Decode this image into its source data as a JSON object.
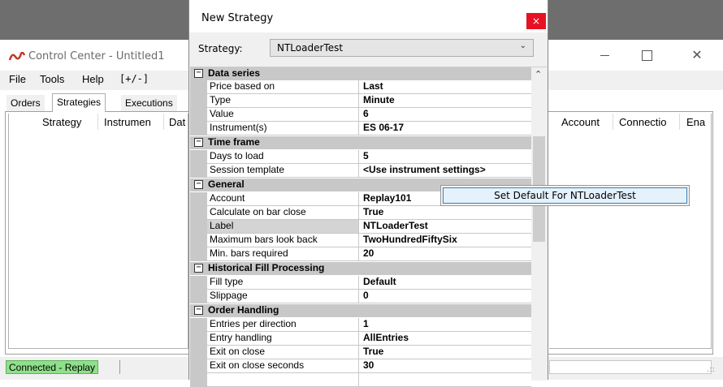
{
  "control_center": {
    "title": "Control Center - Untitled1",
    "menu": [
      "File",
      "Tools",
      "Help",
      "[+/-]"
    ],
    "tabs": [
      "Orders",
      "Strategies",
      "Executions"
    ],
    "columns_left": [
      "Strategy",
      "Instrumen",
      "Dat"
    ],
    "columns_right": [
      "Account",
      "Connectio",
      "Ena"
    ],
    "status": "Connected - Replay",
    "close_glyph": "✕",
    "logo_color": "#c0392b"
  },
  "dialog": {
    "title": "New Strategy",
    "close_glyph": "×",
    "strategy_label": "Strategy:",
    "strategy_value": "NTLoaderTest",
    "sections": [
      {
        "name": "Data series",
        "rows": [
          {
            "name": "Price based on",
            "value": "Last"
          },
          {
            "name": "Type",
            "value": "Minute"
          },
          {
            "name": "Value",
            "value": "6"
          },
          {
            "name": "Instrument(s)",
            "value": "ES 06-17"
          }
        ]
      },
      {
        "name": "Time frame",
        "rows": [
          {
            "name": "Days to load",
            "value": "5"
          },
          {
            "name": "Session template",
            "value": "<Use instrument settings>"
          }
        ]
      },
      {
        "name": "General",
        "rows": [
          {
            "name": "Account",
            "value": "Replay101"
          },
          {
            "name": "Calculate on bar close",
            "value": "True"
          },
          {
            "name": "Label",
            "value": "NTLoaderTest"
          },
          {
            "name": "Maximum bars look back",
            "value": "TwoHundredFiftySix"
          },
          {
            "name": "Min. bars required",
            "value": "20"
          }
        ]
      },
      {
        "name": "Historical Fill Processing",
        "rows": [
          {
            "name": "Fill type",
            "value": "Default"
          },
          {
            "name": "Slippage",
            "value": "0"
          }
        ]
      },
      {
        "name": "Order Handling",
        "rows": [
          {
            "name": "Entries per direction",
            "value": "1"
          },
          {
            "name": "Entry handling",
            "value": "AllEntries"
          },
          {
            "name": "Exit on close",
            "value": "True"
          },
          {
            "name": "Exit on close seconds",
            "value": "30"
          }
        ]
      }
    ]
  },
  "context_menu": {
    "item": "Set Default For NTLoaderTest"
  },
  "colors": {
    "status_green": "#8fe08b",
    "close_red": "#e81123",
    "category_gray": "#c8c8c8",
    "menu_highlight": "#e5f1fb"
  }
}
